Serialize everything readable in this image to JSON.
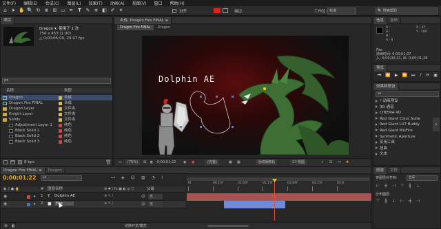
{
  "menu": [
    "文件(F)",
    "编辑(E)",
    "合成(C)",
    "图层(L)",
    "效果(T)",
    "动画(A)",
    "视图(V)",
    "窗口",
    "帮助(H)"
  ],
  "toolbar": {
    "align_label": "对齐",
    "fill_color": "#e0241b",
    "stroke_label": "描边",
    "workspace_label": "工作区:",
    "workspace_value": "标准",
    "search_placeholder": "搜索帮助"
  },
  "project": {
    "tab": "项目",
    "comp_name": "Dragon ▾, 使用了 1 次",
    "comp_info_1": "756 x 453 (1.00)",
    "comp_info_2": "△ 0;00;05;00, 29.97 fps",
    "search_placeholder": "ρ▾",
    "col_name": "名称",
    "col_type": "类型",
    "items": [
      {
        "name": "Dragon",
        "type": "合成",
        "color": "#d4bd4b",
        "kind": "comp",
        "selected": true
      },
      {
        "name": "Dragon Fire FINAL",
        "type": "合成",
        "color": "#d4bd4b",
        "kind": "comp",
        "selected": false
      },
      {
        "name": "Dragon Layer",
        "type": "文件夹",
        "color": "#d4bd4b",
        "kind": "folder",
        "selected": false
      },
      {
        "name": "Knight Layer",
        "type": "文件夹",
        "color": "#d4bd4b",
        "kind": "folder",
        "selected": false
      },
      {
        "name": "Solids",
        "type": "文件夹",
        "color": "#d4bd4b",
        "kind": "folder",
        "selected": false
      },
      {
        "name": "Adjustment Layer 1",
        "type": "纯色",
        "color": "#c84a4a",
        "kind": "solid",
        "selected": false
      },
      {
        "name": "Black Solid 1",
        "type": "纯色",
        "color": "#c84a4a",
        "kind": "solid",
        "selected": false
      },
      {
        "name": "Black Solid 2",
        "type": "纯色",
        "color": "#c84a4a",
        "kind": "solid",
        "selected": false
      },
      {
        "name": "Black Solid 3",
        "type": "纯色",
        "color": "#c84a4a",
        "kind": "solid",
        "selected": false
      }
    ],
    "footer_bpc": "8 bpc"
  },
  "composition": {
    "tab_main": "合成: Dragon Fire FINAL ≡",
    "breadcrumbs": [
      "Dragon Fire FINAL",
      "Dragon"
    ],
    "title_text": "Dolphin AE",
    "footer": {
      "zoom": "(75%)",
      "timecode": "0;00;01;22",
      "res": "(完整)",
      "camera": "活动摄像机",
      "views": "1个视图"
    }
  },
  "right": {
    "info_tab": "信息",
    "audio_tab": "音频",
    "r_label": "R :",
    "g_label": "G :",
    "b_label": "B :",
    "a_label": "A : 0",
    "x_label": "X : 47",
    "y_label": "Y : 100",
    "layer_name": "Fire",
    "time_info_1": "持续时间: 0;00;01;07",
    "time_info_2": "入: 0;00;00;21, 出: 0;00;01;28",
    "preview_tab": "预览",
    "effects_tab": "效果和预设",
    "effects_search": "ρ▾",
    "effects": [
      "* 动画预设",
      "3D 通道",
      "CINEMA 4D",
      "Red Giant Color Suite",
      "Red Giant LUT Buddy",
      "Red Giant MisFire",
      "Synthetic Aperture",
      "实用工具",
      "扭曲",
      "文本"
    ],
    "para_tab": "段落",
    "char_tab": "字符",
    "align_tab_1": "对齐",
    "align_tab_2": "合成",
    "align_label": "将图层对齐到:",
    "align_value": "合成",
    "distribute_label": "分布图层:"
  },
  "timeline": {
    "tabs": [
      "Dragon Fire FINAL ≡",
      "Dragon"
    ],
    "timecode": "0;00;01;22",
    "search_placeholder": "ρ▾",
    "layer_col": "图层名称",
    "parent_col": "父级",
    "ticks": [
      "0f",
      "00:15f",
      "01:00f",
      "01:15f",
      "02:00f",
      "02:15f",
      "03:0"
    ],
    "layers": [
      {
        "num": "1",
        "name": "Dolphin AE",
        "kind": "text",
        "parent": "无",
        "color": "#c84a4a"
      },
      {
        "num": "2",
        "name": "Fire",
        "kind": "solid",
        "parent": "无",
        "color": "#4a6ed8"
      }
    ],
    "footer": "切换开关/模式"
  }
}
